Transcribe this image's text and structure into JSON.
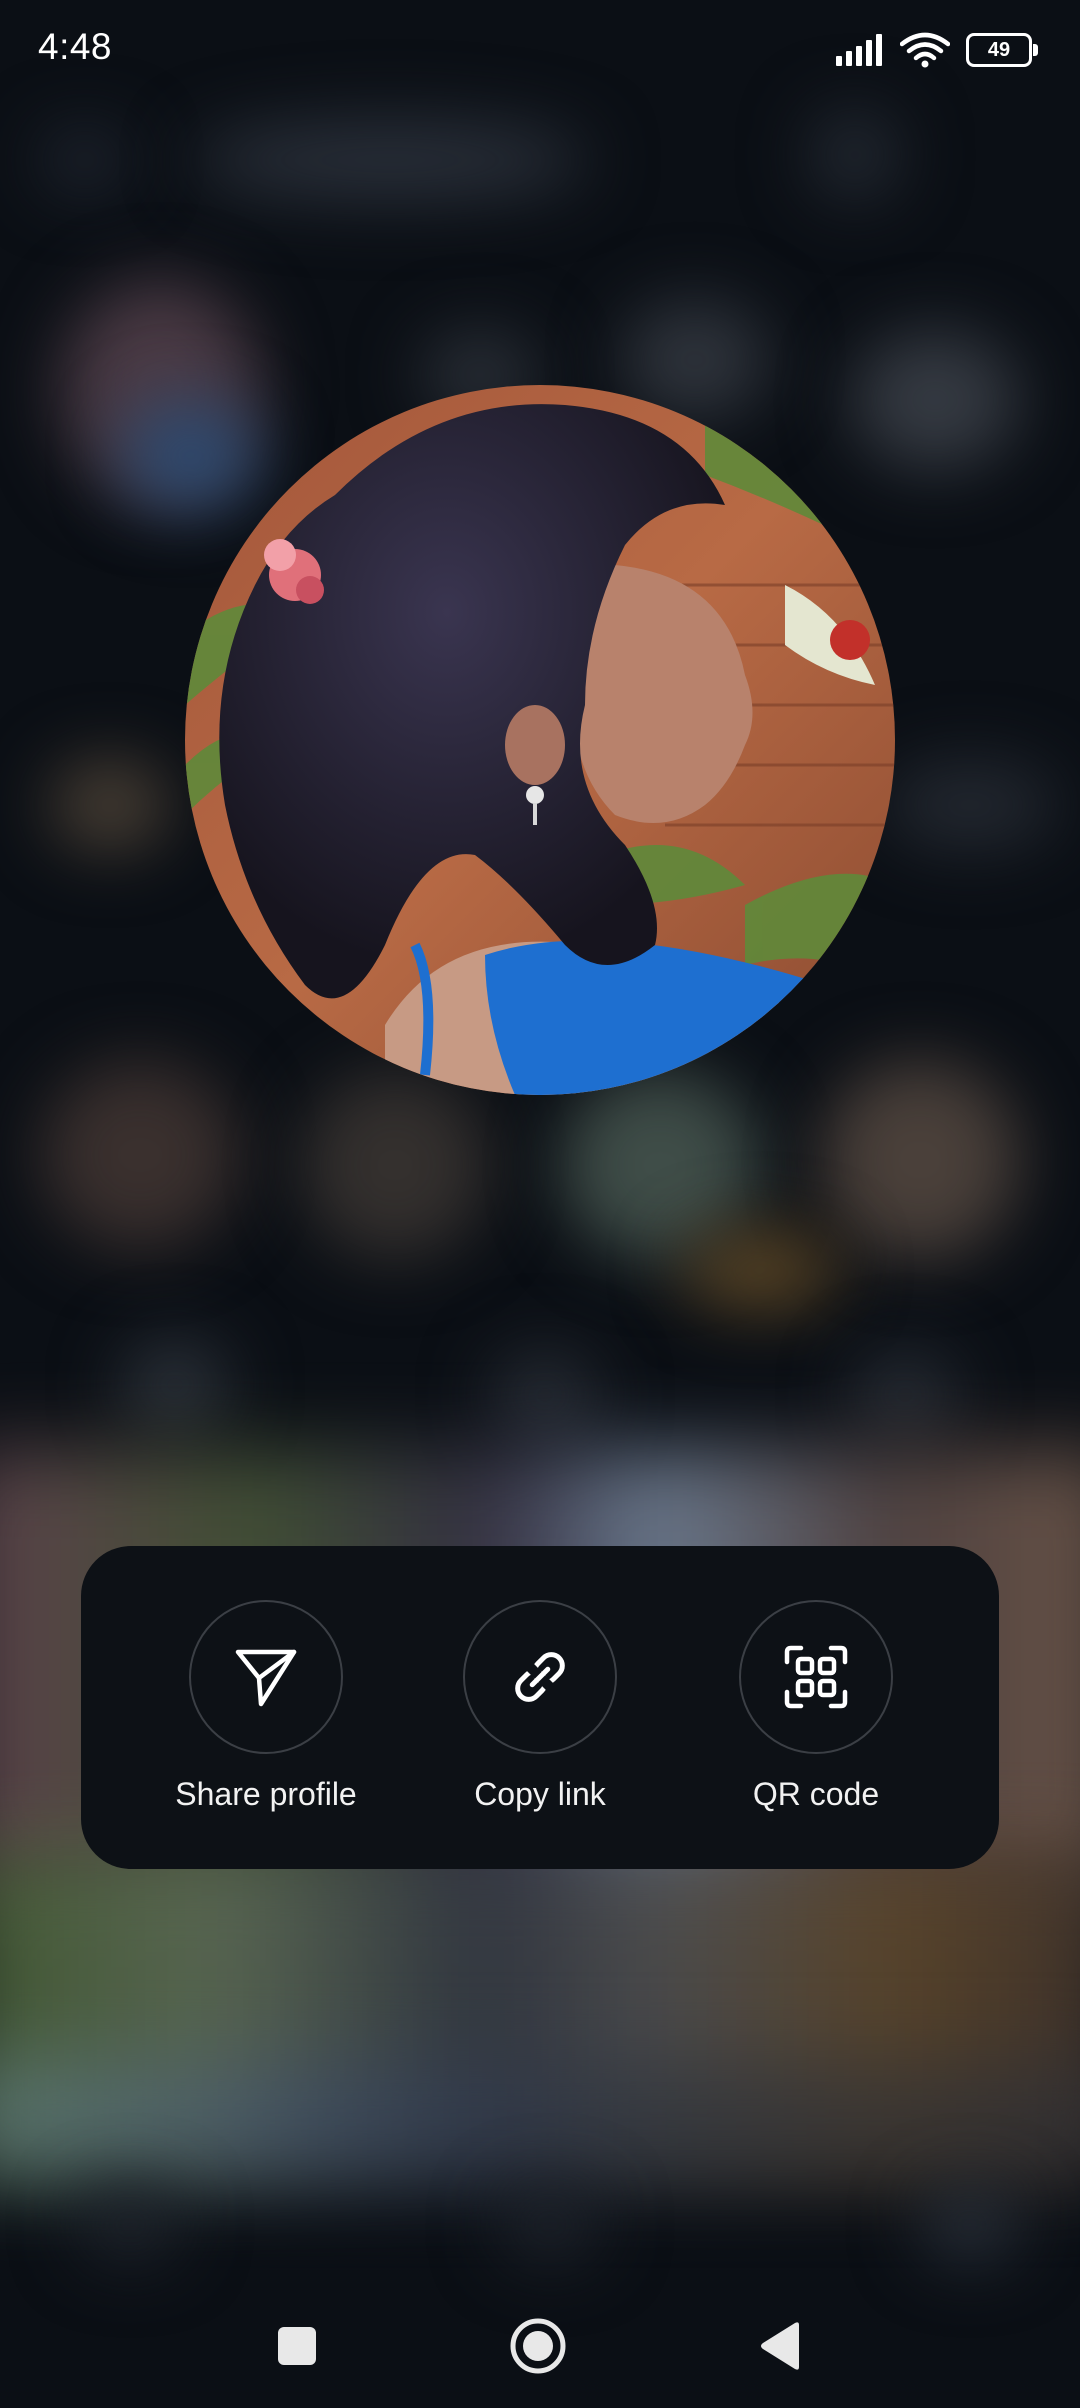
{
  "status_bar": {
    "time": "4:48",
    "battery_level": "49",
    "icons": [
      "signal-icon",
      "wifi-icon",
      "battery-icon"
    ]
  },
  "profile_picture": {
    "icon": "profile-photo"
  },
  "actions": [
    {
      "label": "Share profile",
      "icon": "send-icon"
    },
    {
      "label": "Copy link",
      "icon": "link-icon"
    },
    {
      "label": "QR code",
      "icon": "qr-code-icon"
    }
  ],
  "nav_bar": {
    "icons": [
      "recents-icon",
      "home-icon",
      "back-icon"
    ]
  },
  "colors": {
    "background": "#0b0f15",
    "card": "#0d1116",
    "circle_border": "#3b3f45",
    "text": "#f2f2f2",
    "accent_blue": "#1e6fd0"
  }
}
